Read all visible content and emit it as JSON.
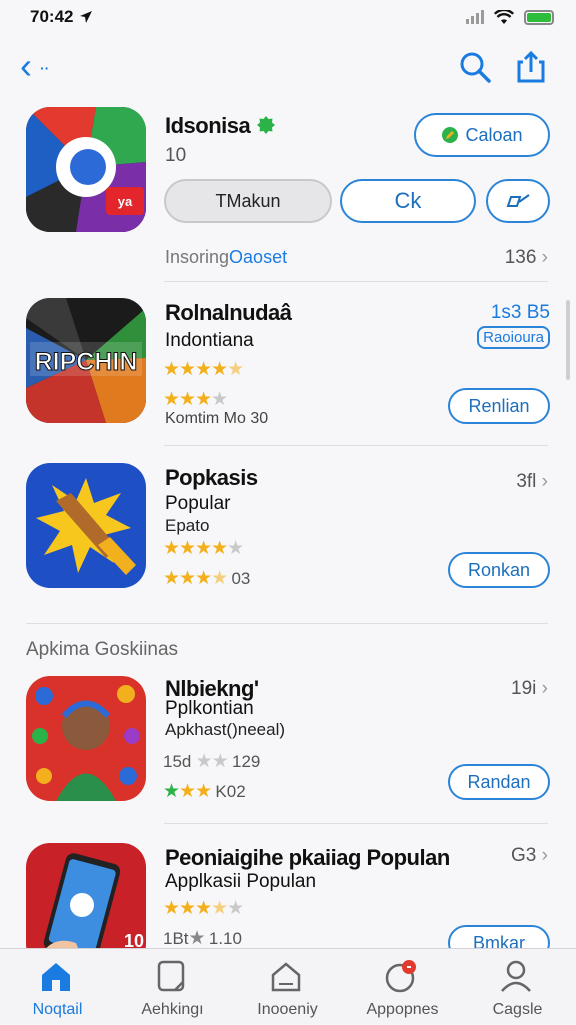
{
  "status": {
    "time": "70:42"
  },
  "colors": {
    "accent": "#1a7be0",
    "star": "#f2b01e",
    "verified": "#2bb34a"
  },
  "featured": {
    "title": "Idsonisa",
    "sub": "10",
    "primary_button": "Caloan",
    "secondary_button": "TMakun",
    "ok_button": "Ck",
    "link_prefix": "Insoring",
    "link_blue": "Oaoset",
    "meta": "136"
  },
  "apps": [
    {
      "title": "Rolnalnudaâ",
      "line2": "Indontiana",
      "rating": 4.5,
      "rating2": 3.5,
      "sub": "Komtim Mo 30",
      "price": "1s3 B5",
      "tag": "Raoioura",
      "button": "Renlian",
      "icon_text": "RIPCHIN"
    },
    {
      "title": "Popkasis",
      "line2": "Popular",
      "line3": "Epato",
      "rating": 4.5,
      "rating2": 3.5,
      "rating_text": "03",
      "meta": "3fl",
      "button": "Ronkan"
    }
  ],
  "section_title": "Apkima Goskiinas",
  "apps2": [
    {
      "title": "Nlbiekng'",
      "line2": "Pplkontian",
      "line3": "Apkhast()neeal)",
      "rating": 2,
      "rating_prefix": "15d",
      "rating_text": "129",
      "rating2": 3,
      "rating2_text": "K02",
      "meta": "19i",
      "button": "Randan"
    },
    {
      "title": "Peoniaigihe pkaiiag Populan",
      "line2": "Applkasii Populan",
      "rating": 3.5,
      "rating2": 1,
      "rating2_prefix": "1Bt",
      "rating2_text": "1.10",
      "meta": "G3",
      "button": "Bmkar",
      "icon_badge": "10"
    }
  ],
  "tabs": [
    {
      "label": "Noqtail",
      "icon": "home-icon"
    },
    {
      "label": "Aehkingı",
      "icon": "tablet-icon"
    },
    {
      "label": "Inooeniy",
      "icon": "house-outline-icon"
    },
    {
      "label": "Appopnes",
      "icon": "apps-badge-icon"
    },
    {
      "label": "Cagsle",
      "icon": "person-icon"
    }
  ]
}
